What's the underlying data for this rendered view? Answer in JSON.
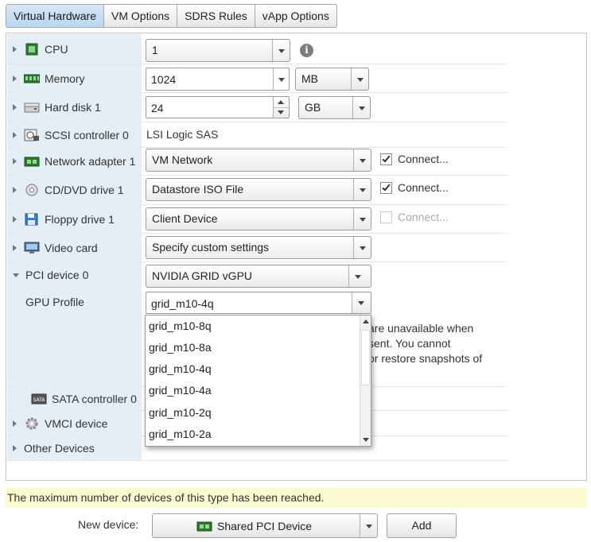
{
  "tabs": [
    "Virtual Hardware",
    "VM Options",
    "SDRS Rules",
    "vApp Options"
  ],
  "devices": {
    "cpu": {
      "label": "CPU",
      "value": "1"
    },
    "memory": {
      "label": "Memory",
      "value": "1024",
      "unit": "MB"
    },
    "harddisk": {
      "label": "Hard disk 1",
      "value": "24",
      "unit": "GB"
    },
    "scsi": {
      "label": "SCSI controller 0",
      "value": "LSI Logic SAS"
    },
    "network": {
      "label": "Network adapter 1",
      "value": "VM Network",
      "connect": "Connect..."
    },
    "cdrom": {
      "label": "CD/DVD drive 1",
      "value": "Datastore ISO File",
      "connect": "Connect..."
    },
    "floppy": {
      "label": "Floppy drive 1",
      "value": "Client Device",
      "connect": "Connect..."
    },
    "video": {
      "label": "Video card",
      "value": "Specify custom settings"
    },
    "pci": {
      "label": "PCI device 0",
      "value": "NVIDIA GRID vGPU"
    },
    "gpu_profile": {
      "label": "GPU Profile",
      "value": "grid_m10-4q"
    },
    "note": {
      "line1": "are unavailable when",
      "line2": "sent. You cannot",
      "line3": "or restore snapshots of"
    },
    "sata": {
      "label": "SATA controller 0"
    },
    "vmci": {
      "label": "VMCI device"
    },
    "other": {
      "label": "Other Devices"
    }
  },
  "gpu_profile_options": [
    "grid_m10-8q",
    "grid_m10-8a",
    "grid_m10-4q",
    "grid_m10-4a",
    "grid_m10-2q",
    "grid_m10-2a"
  ],
  "warning": "The maximum number of devices of this type has been reached.",
  "new_device": {
    "label": "New device:",
    "value": "Shared PCI Device",
    "add": "Add"
  },
  "colors": {
    "accent": "#b9d6f0",
    "left_column": "#e4eef6",
    "warning_bg": "#fcfbd0"
  }
}
